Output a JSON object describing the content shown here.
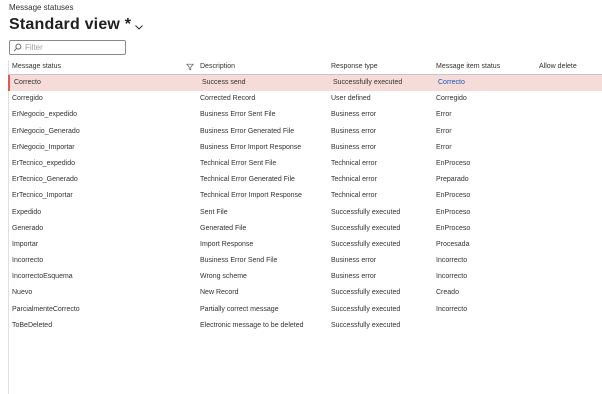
{
  "page": {
    "caption": "Message statuses",
    "view_title": "Standard view *"
  },
  "filter": {
    "placeholder": "Filter",
    "value": ""
  },
  "grid": {
    "columns": [
      "Message status",
      "Description",
      "Response type",
      "Message item status",
      "Allow delete"
    ],
    "rows": [
      {
        "status": "Correcto",
        "description": "Success send",
        "response": "Successfully executed",
        "item_status": "Correcto",
        "allow_delete": "",
        "selected": true
      },
      {
        "status": "Corregido",
        "description": "Corrected Record",
        "response": "User defined",
        "item_status": "Corregido",
        "allow_delete": ""
      },
      {
        "status": "ErNegocio_expedido",
        "description": "Business Error Sent File",
        "response": "Business error",
        "item_status": "Error",
        "allow_delete": ""
      },
      {
        "status": "ErNegocio_Generado",
        "description": "Business Error Generated File",
        "response": "Business error",
        "item_status": "Error",
        "allow_delete": ""
      },
      {
        "status": "ErNegocio_Importar",
        "description": "Business Error Import Response",
        "response": "Business error",
        "item_status": "Error",
        "allow_delete": ""
      },
      {
        "status": "ErTecnico_expedido",
        "description": "Technical Error Sent File",
        "response": "Technical error",
        "item_status": "EnProceso",
        "allow_delete": ""
      },
      {
        "status": "ErTecnico_Generado",
        "description": "Technical Error Generated File",
        "response": "Technical error",
        "item_status": "Preparado",
        "allow_delete": ""
      },
      {
        "status": "ErTecnico_Importar",
        "description": "Technical Error Import Response",
        "response": "Technical error",
        "item_status": "EnProceso",
        "allow_delete": ""
      },
      {
        "status": "Expedido",
        "description": "Sent File",
        "response": "Successfully executed",
        "item_status": "EnProceso",
        "allow_delete": ""
      },
      {
        "status": "Generado",
        "description": "Generated File",
        "response": "Successfully executed",
        "item_status": "EnProceso",
        "allow_delete": ""
      },
      {
        "status": "Importar",
        "description": "Import Response",
        "response": "Successfully executed",
        "item_status": "Procesada",
        "allow_delete": ""
      },
      {
        "status": "Incorrecto",
        "description": "Business Error Send File",
        "response": "Business error",
        "item_status": "Incorrecto",
        "allow_delete": ""
      },
      {
        "status": "IncorrectoEsquema",
        "description": "Wrong scheme",
        "response": "Business error",
        "item_status": "Incorrecto",
        "allow_delete": ""
      },
      {
        "status": "Nuevo",
        "description": "New Record",
        "response": "Successfully executed",
        "item_status": "Creado",
        "allow_delete": ""
      },
      {
        "status": "ParcialmenteCorrecto",
        "description": "Partially correct message",
        "response": "Successfully executed",
        "item_status": "Incorrecto",
        "allow_delete": ""
      },
      {
        "status": "ToBeDeleted",
        "description": "Electronic message to be deleted",
        "response": "Successfully executed",
        "item_status": "",
        "allow_delete": ""
      }
    ]
  },
  "icons": {
    "view_dropdown": "chevron-down-icon",
    "filter_search": "search-icon",
    "column_filter": "funnel-icon"
  },
  "colors": {
    "selected_row_bg": "#f6dcd9",
    "selected_row_accent": "#e05a4e",
    "link_blue": "#1457b8"
  }
}
